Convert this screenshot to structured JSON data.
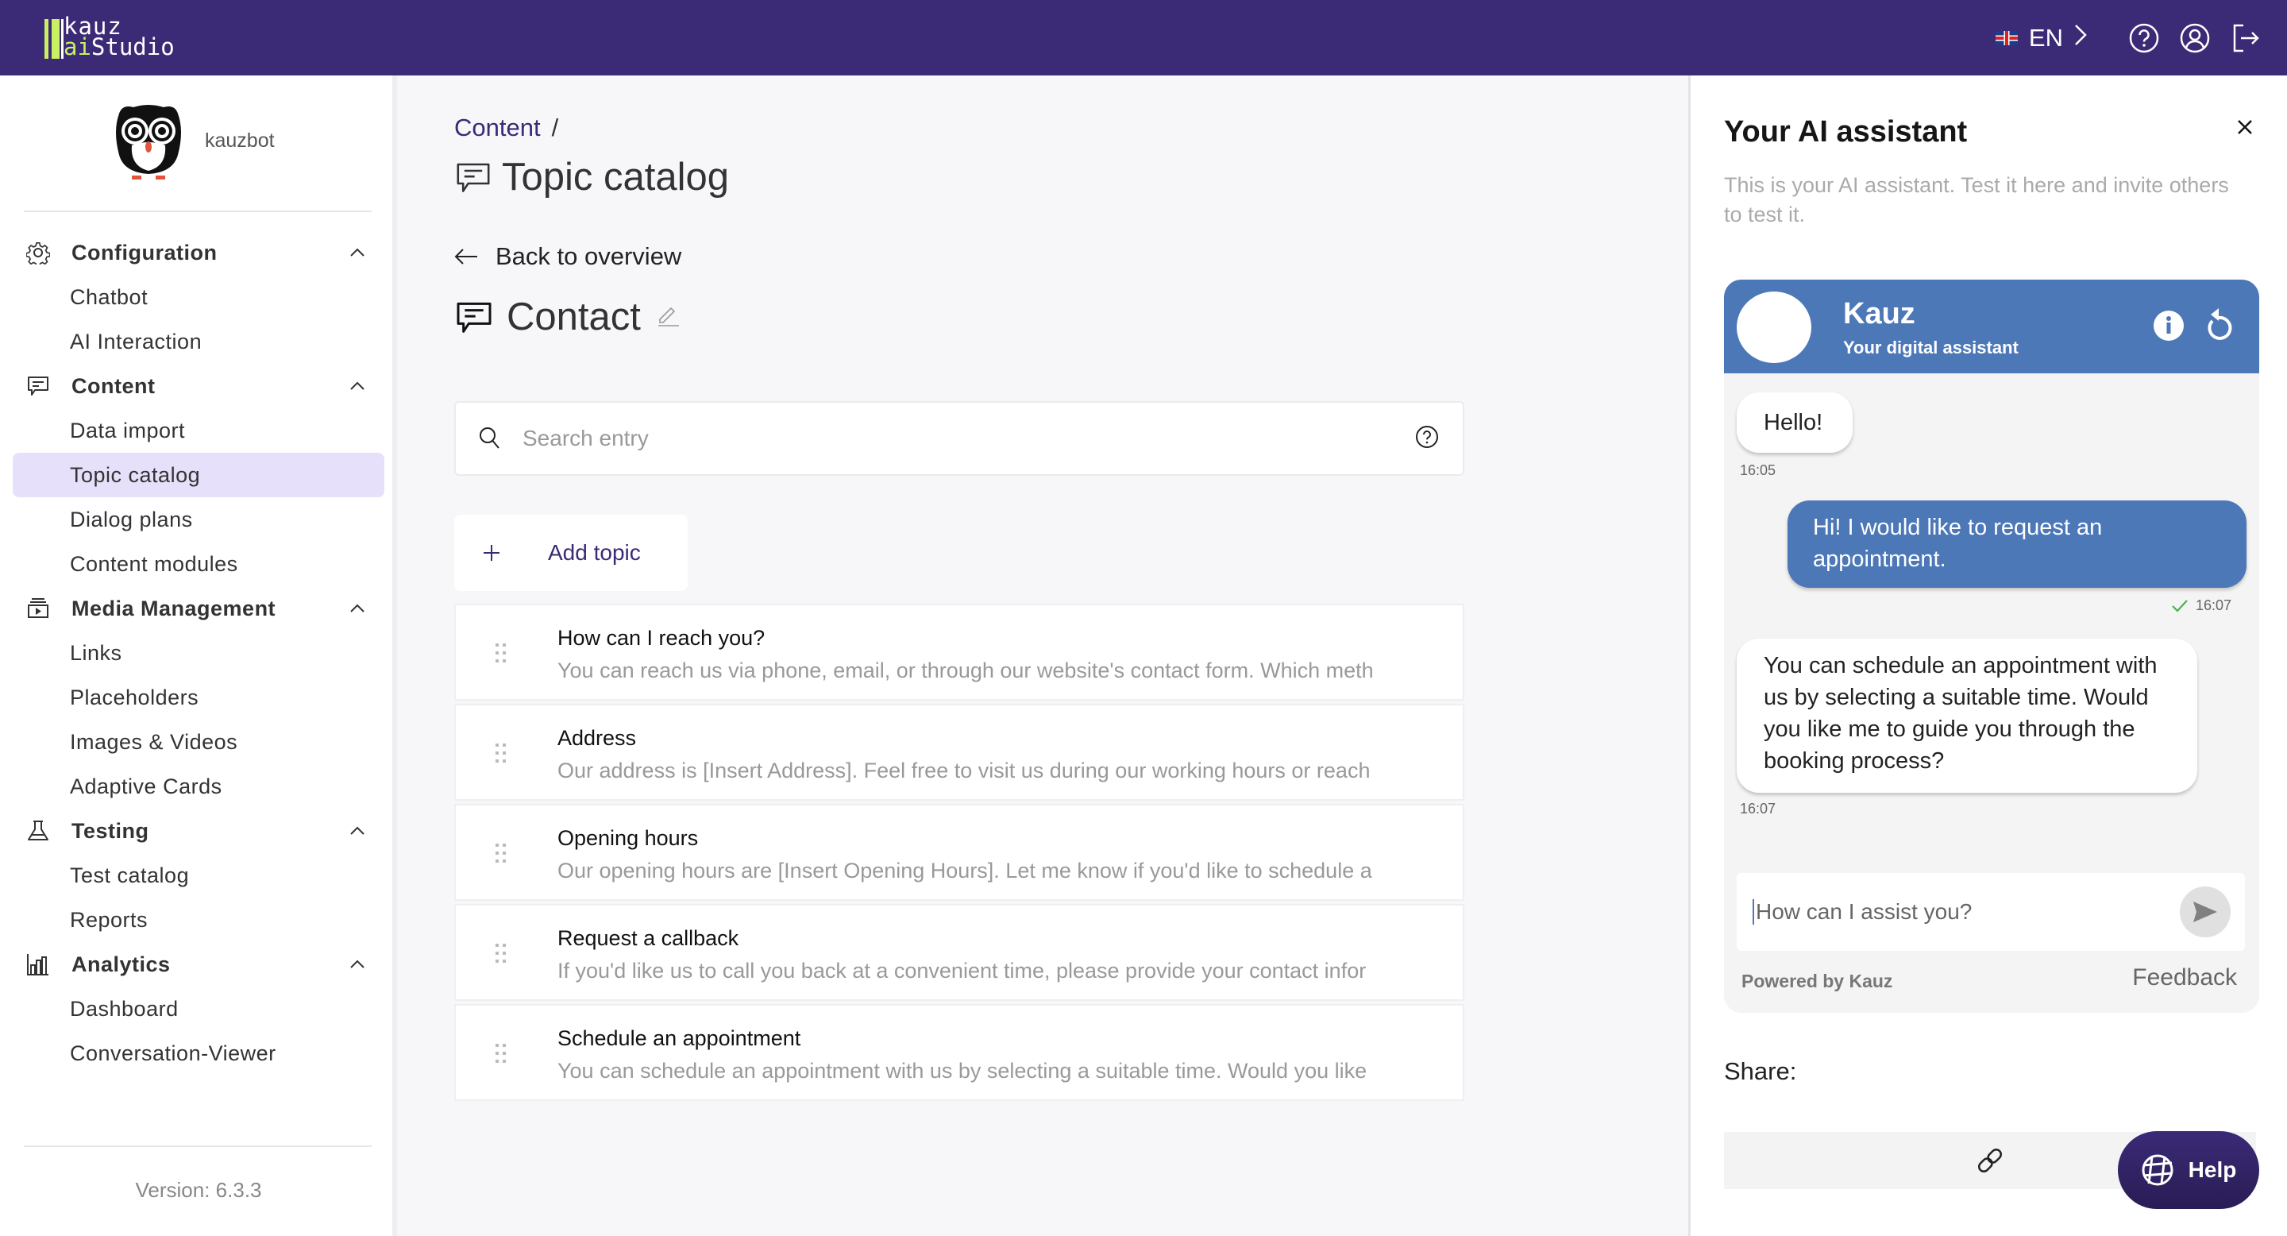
{
  "app": {
    "logo_line1": "kauz",
    "logo_line2_accent": "ai",
    "logo_line2_rest": "Studio",
    "brand_color": "#3b2a76",
    "accent_color": "#c8f060"
  },
  "topbar": {
    "language": "EN",
    "icons": [
      "help-circle-icon",
      "user-account-icon",
      "logout-icon"
    ]
  },
  "sidebar": {
    "bot_name": "kauzbot",
    "groups": [
      {
        "label": "Configuration",
        "icon": "gear-icon",
        "items": [
          {
            "label": "Chatbot"
          },
          {
            "label": "AI Interaction"
          }
        ]
      },
      {
        "label": "Content",
        "icon": "chat-icon",
        "items": [
          {
            "label": "Data import"
          },
          {
            "label": "Topic catalog",
            "active": true
          },
          {
            "label": "Dialog plans"
          },
          {
            "label": "Content modules"
          }
        ]
      },
      {
        "label": "Media Management",
        "icon": "media-icon",
        "items": [
          {
            "label": "Links"
          },
          {
            "label": "Placeholders"
          },
          {
            "label": "Images & Videos"
          },
          {
            "label": "Adaptive Cards"
          }
        ]
      },
      {
        "label": "Testing",
        "icon": "flask-icon",
        "items": [
          {
            "label": "Test catalog"
          },
          {
            "label": "Reports"
          }
        ]
      },
      {
        "label": "Analytics",
        "icon": "bar-chart-icon",
        "items": [
          {
            "label": "Dashboard"
          },
          {
            "label": "Conversation-Viewer"
          }
        ]
      }
    ],
    "version": "Version: 6.3.3"
  },
  "main": {
    "breadcrumb": {
      "parent": "Content",
      "separator": "/"
    },
    "page_title": "Topic catalog",
    "back_label": "Back to overview",
    "topic_title": "Contact",
    "search_placeholder": "Search entry",
    "add_topic_label": "Add topic",
    "topics": [
      {
        "name": "How can I reach you?",
        "description": "You can reach us via phone, email, or through our website's contact form. Which meth"
      },
      {
        "name": "Address",
        "description": "Our address is [Insert Address]. Feel free to visit us during our working hours or reach"
      },
      {
        "name": "Opening hours",
        "description": "Our opening hours are [Insert Opening Hours]. Let me know if you'd like to schedule a"
      },
      {
        "name": "Request a callback",
        "description": "If you'd like us to call you back at a convenient time, please provide your contact infor"
      },
      {
        "name": "Schedule an appointment",
        "description": "You can schedule an appointment with us by selecting a suitable time. Would you like"
      }
    ]
  },
  "assistant_panel": {
    "title": "Your AI assistant",
    "description": "This is your AI assistant. Test it here and invite others to test it.",
    "widget": {
      "name": "Kauz",
      "subtitle": "Your digital assistant",
      "header_color": "#4d78b7",
      "messages": [
        {
          "from": "bot",
          "text": "Hello!",
          "time": "16:05"
        },
        {
          "from": "user",
          "text": "Hi! I would like to request an appointment.",
          "time": "16:07",
          "status": "delivered"
        },
        {
          "from": "bot",
          "text": "You can schedule an appointment with us by selecting a suitable time. Would you like me to guide you through the booking process?",
          "time": "16:07"
        }
      ],
      "input_placeholder": "How can I assist you?",
      "powered_by": "Powered by Kauz",
      "feedback_label": "Feedback"
    },
    "share_label": "Share:",
    "help_label": "Help"
  }
}
